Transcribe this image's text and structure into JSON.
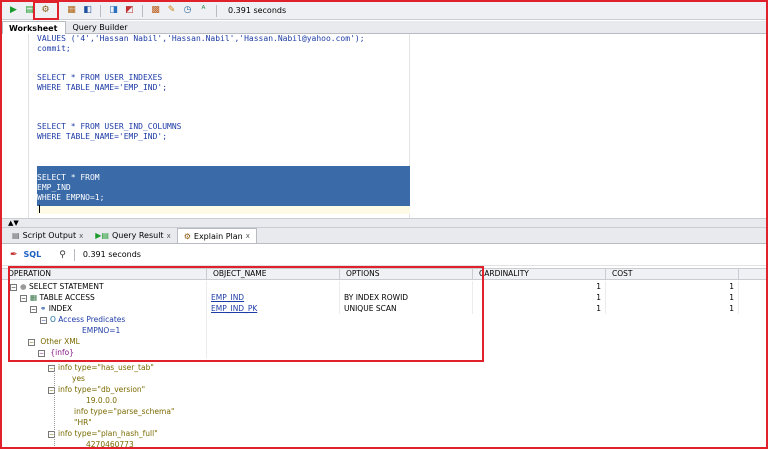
{
  "toolbar": {
    "time": "0.391 seconds",
    "buttons": [
      "run-statement-icon",
      "run-script-icon",
      "explain-plan-icon",
      "autotrace-icon",
      "sql-tuning-icon",
      "commit-icon",
      "rollback-icon",
      "unshared-sql-icon",
      "clear-icon",
      "history-icon",
      "format-icon"
    ]
  },
  "tabs_top": {
    "worksheet": "Worksheet",
    "query_builder": "Query Builder"
  },
  "editor": {
    "lines": [
      "VALUES ('4','Hassan Nabil','Hassan.Nabil','Hassan.Nabil@yahoo.com');",
      "commit;",
      "",
      "",
      "SELECT * FROM USER_INDEXES",
      "WHERE TABLE_NAME='EMP_IND';",
      "",
      "",
      "",
      "SELECT * FROM USER_IND_COLUMNS",
      "WHERE TABLE_NAME='EMP_IND';"
    ],
    "selected_lines": [
      "SELECT * FROM",
      "EMP_IND",
      "WHERE EMPNO=1;"
    ]
  },
  "bottom_tabs": {
    "script_output": "Script Output",
    "query_result": "Query Result",
    "explain_plan": "Explain Plan",
    "close": "x"
  },
  "plan_toolbar": {
    "sql_label": "SQL",
    "time": "0.391 seconds"
  },
  "grid": {
    "headers": [
      "OPERATION",
      "OBJECT_NAME",
      "OPTIONS",
      "CARDINALITY",
      "COST"
    ],
    "rows": [
      {
        "operation": "SELECT STATEMENT",
        "object": "",
        "options": "",
        "cardinality": "1",
        "cost": "1"
      },
      {
        "operation": "TABLE ACCESS",
        "object": "EMP_IND",
        "options": "BY INDEX ROWID",
        "cardinality": "1",
        "cost": "1"
      },
      {
        "operation": "INDEX",
        "object": "EMP_IND_PK",
        "options": "UNIQUE SCAN",
        "cardinality": "1",
        "cost": "1"
      },
      {
        "operation": "Access Predicates",
        "object": "",
        "options": "",
        "cardinality": "",
        "cost": ""
      },
      {
        "operation": "EMPNO=1",
        "object": "",
        "options": "",
        "cardinality": "",
        "cost": ""
      },
      {
        "operation": "Other XML",
        "object": "",
        "options": "",
        "cardinality": "",
        "cost": ""
      },
      {
        "operation": "{info}",
        "object": "",
        "options": "",
        "cardinality": "",
        "cost": ""
      }
    ]
  },
  "xml_tree": [
    "info type=\"has_user_tab\"",
    "yes",
    "info type=\"db_version\"",
    "19.0.0.0",
    "info type=\"parse_schema\"",
    "\"HR\"",
    "info type=\"plan_hash_full\"",
    "4270460773"
  ]
}
